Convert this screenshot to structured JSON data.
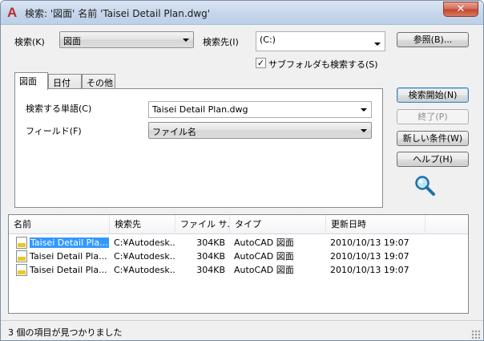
{
  "window": {
    "title": "検索: '図面' 名前 'Taisei Detail Plan.dwg'",
    "close_glyph": "✕",
    "app_glyph": "A"
  },
  "search_bar": {
    "search_label": "検索(K)",
    "search_value": "図面",
    "location_label": "検索先(I)",
    "location_value": "(C:)",
    "browse_label": "参照(B)...",
    "subfolder_label": "サブフォルダも検索する(S)",
    "subfolder_checked": "✓"
  },
  "tabs": [
    {
      "label": "図面"
    },
    {
      "label": "日付"
    },
    {
      "label": "その他"
    }
  ],
  "criteria": {
    "word_label": "検索する単語(C)",
    "word_value": "Taisei Detail Plan.dwg",
    "field_label": "フィールド(F)",
    "field_value": "ファイル名"
  },
  "actions": {
    "start": "検索開始(N)",
    "stop": "終了(P)",
    "new_criteria": "新しい条件(W)",
    "help": "ヘルプ(H)",
    "search_icon": "magnifier-icon"
  },
  "results": {
    "columns": [
      "名前",
      "検索先",
      "ファイル サ...",
      "タイプ",
      "更新日時"
    ],
    "rows": [
      {
        "name": "Taisei Detail Pla...",
        "location": "C:¥Autodesk...",
        "size": "304KB",
        "type": "AutoCAD 図面",
        "modified": "2010/10/13 19:07"
      },
      {
        "name": "Taisei Detail Pla...",
        "location": "C:¥Autodesk...",
        "size": "304KB",
        "type": "AutoCAD 図面",
        "modified": "2010/10/13 19:07"
      },
      {
        "name": "Taisei Detail Pla...",
        "location": "C:¥Autodesk...",
        "size": "304KB",
        "type": "AutoCAD 図面",
        "modified": "2010/10/13 19:07"
      }
    ]
  },
  "status": {
    "text": "3 個の項目が見つかりました"
  },
  "colors": {
    "selection": "#3399ff",
    "app_icon": "#c0282e",
    "close_button": "#c3442b"
  }
}
